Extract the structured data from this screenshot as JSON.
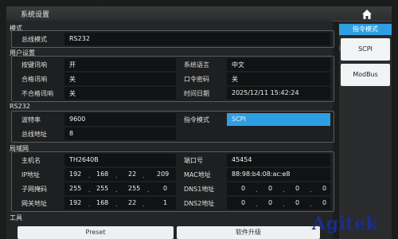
{
  "window": {
    "title": "系统设置"
  },
  "sections": {
    "mode": "模式",
    "user": "用户设置",
    "rs232": "RS232",
    "lan": "局域网",
    "tools": "工具"
  },
  "mode": {
    "bus_label": "总线模式",
    "bus_value": "RS232"
  },
  "user": {
    "key_beep_label": "按键讯响",
    "key_beep_value": "开",
    "lang_label": "系统语言",
    "lang_value": "中文",
    "pass_beep_label": "合格讯响",
    "pass_beep_value": "关",
    "pwd_label": "口令密码",
    "pwd_value": "关",
    "fail_beep_label": "不合格讯响",
    "fail_beep_value": "关",
    "datetime_label": "时间日期",
    "datetime_value": "2025/12/11 15:42:24"
  },
  "rs232": {
    "baud_label": "波特率",
    "baud_value": "9600",
    "cmd_label": "指令模式",
    "cmd_value": "SCPI",
    "addr_label": "总线地址",
    "addr_value": "8"
  },
  "lan": {
    "host_label": "主机名",
    "host_value": "TH2640B",
    "port_label": "端口号",
    "port_value": "45454",
    "ip_label": "IP地址",
    "ip": [
      "192",
      "168",
      "22",
      "209"
    ],
    "mac_label": "MAC地址",
    "mac_value": "88:98:b4:08:ac:e8",
    "mask_label": "子网掩码",
    "mask": [
      "255",
      "255",
      "255",
      "0"
    ],
    "dns1_label": "DNS1地址",
    "dns1": [
      "0",
      "0",
      "0",
      "0"
    ],
    "gw_label": "网关地址",
    "gw": [
      "192",
      "168",
      "22",
      "1"
    ],
    "dns2_label": "DNS2地址",
    "dns2": [
      "0",
      "0",
      "0",
      "0"
    ]
  },
  "tools": {
    "preset": "Preset",
    "upgrade": "软件升级"
  },
  "sidebar": {
    "header": "指令模式",
    "items": [
      "SCPI",
      "ModBus"
    ]
  },
  "watermark": "Agitek",
  "colors": {
    "accent": "#2f9fe3",
    "background": "#1b1c1c",
    "logo": "#1a2f8a"
  }
}
